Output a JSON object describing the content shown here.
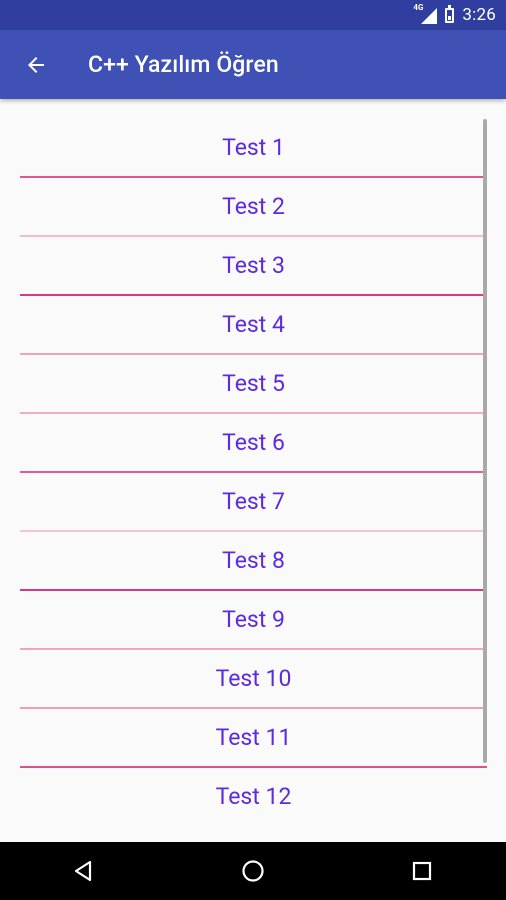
{
  "status_bar": {
    "network_label": "4G",
    "time": "3:26"
  },
  "app_bar": {
    "title": "C++ Yazılım Öğren",
    "back_icon": "arrow-back-icon"
  },
  "tests": [
    {
      "label": "Test 1",
      "divider_color": "#e1588f"
    },
    {
      "label": "Test 2",
      "divider_color": "#f7bcc9"
    },
    {
      "label": "Test 3",
      "divider_color": "#d83c7d"
    },
    {
      "label": "Test 4",
      "divider_color": "#f0a2b8"
    },
    {
      "label": "Test 5",
      "divider_color": "#f2aec0"
    },
    {
      "label": "Test 6",
      "divider_color": "#df5d92"
    },
    {
      "label": "Test 7",
      "divider_color": "#f7c3cf"
    },
    {
      "label": "Test 8",
      "divider_color": "#d43a7a"
    },
    {
      "label": "Test 9",
      "divider_color": "#f0a6ba"
    },
    {
      "label": "Test 10",
      "divider_color": "#ee9fb6"
    },
    {
      "label": "Test 11",
      "divider_color": "#dd4f88"
    },
    {
      "label": "Test 12",
      "divider_color": "transparent"
    }
  ],
  "colors": {
    "primary": "#3f51b5",
    "primary_dark": "#303f9f",
    "item_text": "#5b2be0",
    "background": "#fafafa"
  },
  "nav": {
    "back_icon": "triangle-back-icon",
    "home_icon": "circle-home-icon",
    "recents_icon": "square-recents-icon"
  }
}
